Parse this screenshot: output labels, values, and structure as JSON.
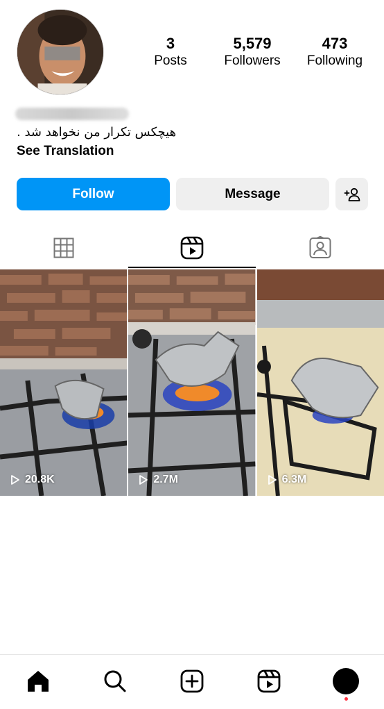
{
  "profile": {
    "bio": "هیچکس تکرار من نخواهد شد .",
    "see_translation": "See Translation"
  },
  "stats": {
    "posts": {
      "value": "3",
      "label": "Posts"
    },
    "followers": {
      "value": "5,579",
      "label": "Followers"
    },
    "following": {
      "value": "473",
      "label": "Following"
    }
  },
  "actions": {
    "follow_label": "Follow",
    "message_label": "Message",
    "add_user_icon": "add-user-icon"
  },
  "tabs": [
    {
      "name": "posts-grid-icon",
      "active": false
    },
    {
      "name": "reels-icon",
      "active": true
    },
    {
      "name": "tagged-icon",
      "active": false
    }
  ],
  "reels": [
    {
      "views": "20.8K"
    },
    {
      "views": "2.7M"
    },
    {
      "views": "6.3M"
    }
  ],
  "bottom_nav": [
    "home-icon",
    "search-icon",
    "create-icon",
    "reels-nav-icon",
    "profile-icon"
  ],
  "colors": {
    "accent": "#0095f6",
    "secondary_button": "#efefef",
    "notification": "#ff3040"
  }
}
